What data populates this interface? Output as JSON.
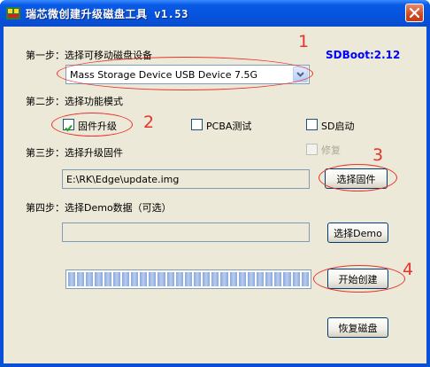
{
  "window": {
    "title": "瑞芯微创建升级磁盘工具 v1.53",
    "titlebar_color": "#0553dd"
  },
  "sdboot_label": "SDBoot:2.12",
  "step1": {
    "label": "第一步：选择可移动磁盘设备",
    "device_selected": "Mass Storage Device USB Device   7.5G"
  },
  "step2": {
    "label": "第二步：选择功能模式",
    "options": [
      {
        "label": "固件升级",
        "checked": true
      },
      {
        "label": "PCBA测试",
        "checked": false
      },
      {
        "label": "SD启动",
        "checked": false
      },
      {
        "label": "修复",
        "checked": false,
        "disabled": true
      }
    ]
  },
  "step3": {
    "label": "第三步：选择升级固件",
    "path": "E:\\RK\\Edge\\update.img",
    "select_button": "选择固件"
  },
  "step4": {
    "label": "第四步：选择Demo数据（可选）",
    "path": "",
    "select_button": "选择Demo"
  },
  "progress": {
    "fraction": 1.0,
    "segments": 27
  },
  "buttons": {
    "start": "开始创建",
    "restore": "恢复磁盘"
  },
  "annotations": [
    "1",
    "2",
    "3",
    "4"
  ],
  "annotation_color": "#e8322a"
}
